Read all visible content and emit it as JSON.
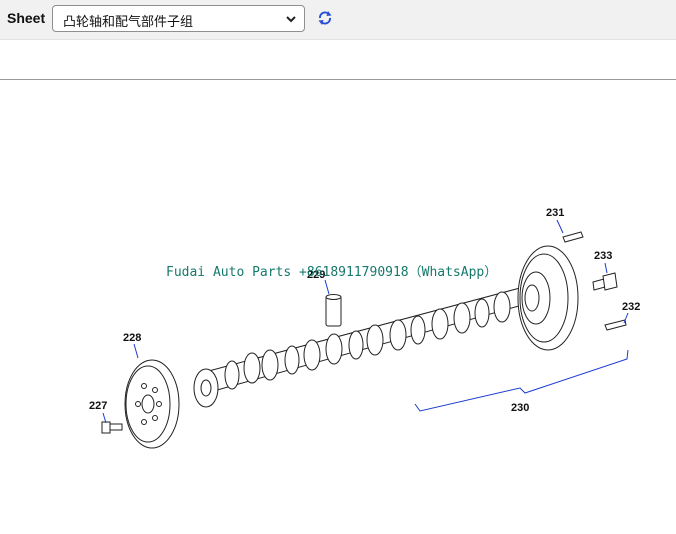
{
  "toolbar": {
    "sheet_label": "Sheet",
    "sheet_select_value": "凸轮轴和配气部件子组"
  },
  "watermark": "Fudai Auto Parts +8618911790918（WhatsApp）",
  "callouts": {
    "c227": "227",
    "c228": "228",
    "c229": "229",
    "c230": "230",
    "c231": "231",
    "c232": "232",
    "c233": "233"
  },
  "icons": {
    "chevron": "chevron-down-icon",
    "refresh": "refresh-icon"
  },
  "colors": {
    "toolbar_bg": "#f1f1f1",
    "leader_line": "#1a3bd1",
    "watermark": "#17796b"
  }
}
